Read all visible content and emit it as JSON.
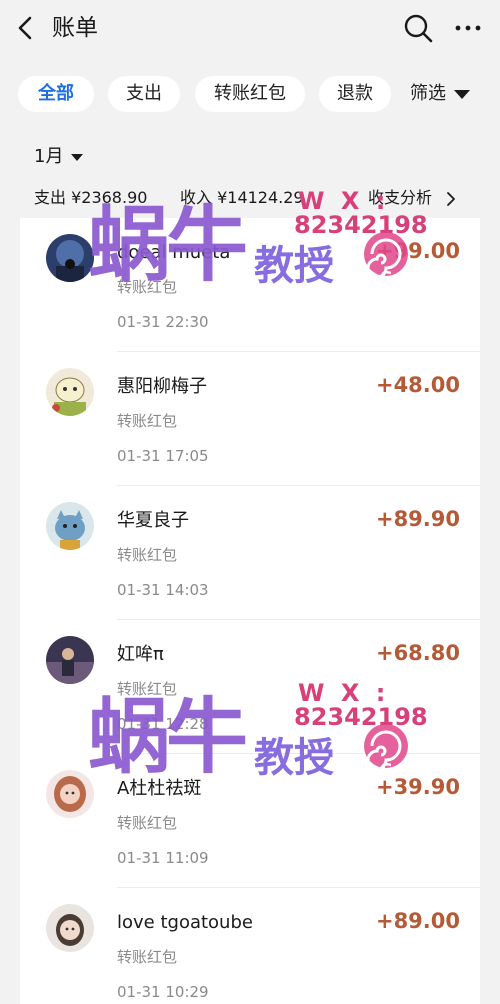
{
  "header": {
    "title": "账单"
  },
  "filters": {
    "chips": [
      "全部",
      "支出",
      "转账红包",
      "退款"
    ],
    "screen_label": "筛选"
  },
  "month": "1月",
  "summary": {
    "expense": "支出 ¥2368.90",
    "income": "收入 ¥14124.29",
    "analysis": "收支分析"
  },
  "transactions": [
    {
      "name": "doeal mueta",
      "type": "转账红包",
      "time": "01-31 22:30",
      "amount": "+99.00"
    },
    {
      "name": "惠阳柳梅子",
      "type": "转账红包",
      "time": "01-31 17:05",
      "amount": "+48.00"
    },
    {
      "name": "华夏良子",
      "type": "转账红包",
      "time": "01-31 14:03",
      "amount": "+89.90"
    },
    {
      "name": "妅哞π",
      "type": "转账红包",
      "time": "01-31 12:28",
      "amount": "+68.80"
    },
    {
      "name": "A杜杜祛斑",
      "type": "转账红包",
      "time": "01-31 11:09",
      "amount": "+39.90"
    },
    {
      "name": "love tgoatoube",
      "type": "转账红包",
      "time": "01-31 10:29",
      "amount": "+89.00"
    }
  ],
  "watermark": {
    "brand": "蜗牛",
    "subtitle": "教授",
    "wx_label": "W X :",
    "wx_number": "82342198",
    "mark": "Dr.Snail"
  },
  "colors": {
    "accent": "#1f6fe0",
    "income_amount": "#b55a37",
    "background": "#f2f2f2",
    "card": "#ffffff",
    "watermark_top": "#e0458a",
    "watermark_bottom": "#6a6ff0"
  },
  "icons": [
    "back-icon",
    "search-icon",
    "more-icon",
    "dropdown-icon",
    "chevron-right-icon"
  ]
}
